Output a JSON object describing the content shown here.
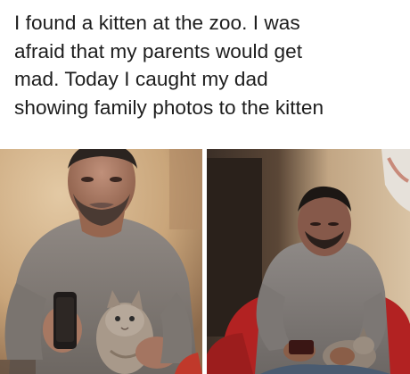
{
  "post": {
    "caption_lines": [
      "I found a kitten at the zoo. I was",
      "afraid that my parents would get",
      "mad. Today I caught my dad",
      "showing family photos to the kitten"
    ]
  },
  "photos": [
    {
      "subject": "man holding phone near kitten",
      "colors": {
        "wall": "#d4b58e",
        "shirt": "#8b8580",
        "skin": "#a87860",
        "hair": "#2b2420",
        "sofa": "#c0392b",
        "kitten": "#a8998a"
      }
    },
    {
      "subject": "man on sofa looking down at kitten",
      "colors": {
        "wall": "#b79b7a",
        "dark_wall": "#3a2e26",
        "shirt": "#8a8582",
        "skin": "#8a5e48",
        "hair": "#1c1714",
        "sofa": "#b22222",
        "jeans": "#4a5b70"
      }
    }
  ]
}
